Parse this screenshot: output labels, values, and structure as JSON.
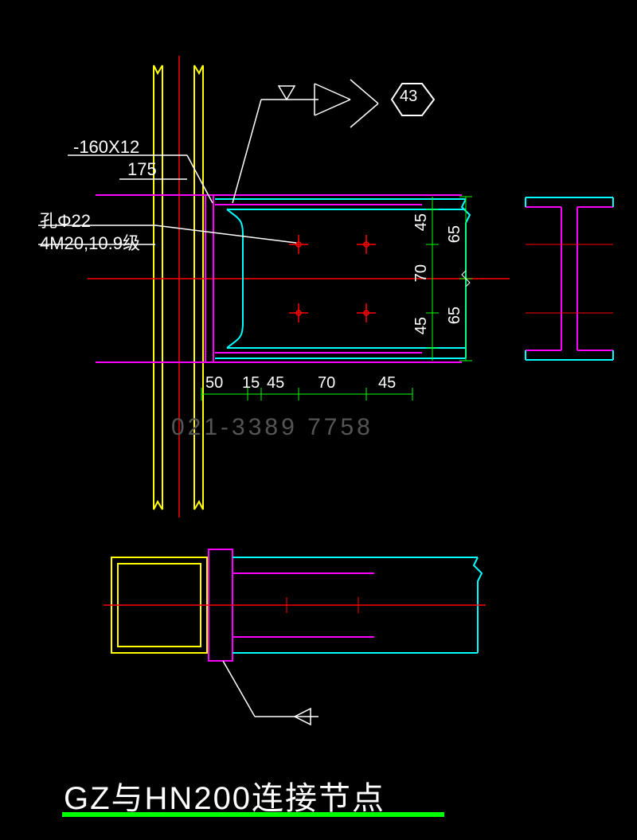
{
  "title": "GZ与HN200连接节点",
  "detail_ref": "43",
  "plate_spec": "-160X12",
  "plate_width": "175",
  "hole_spec": "孔Φ22",
  "bolt_spec": "4M20,10.9级",
  "dims_horizontal": {
    "d1": "50",
    "d2": "15",
    "d3": "45",
    "d4": "70",
    "d5": "45"
  },
  "dims_vertical_inner": {
    "top": "45",
    "mid": "70",
    "bot": "45"
  },
  "dims_vertical_outer": {
    "top": "65",
    "bot": "65"
  },
  "watermark": "021-3389 7758"
}
